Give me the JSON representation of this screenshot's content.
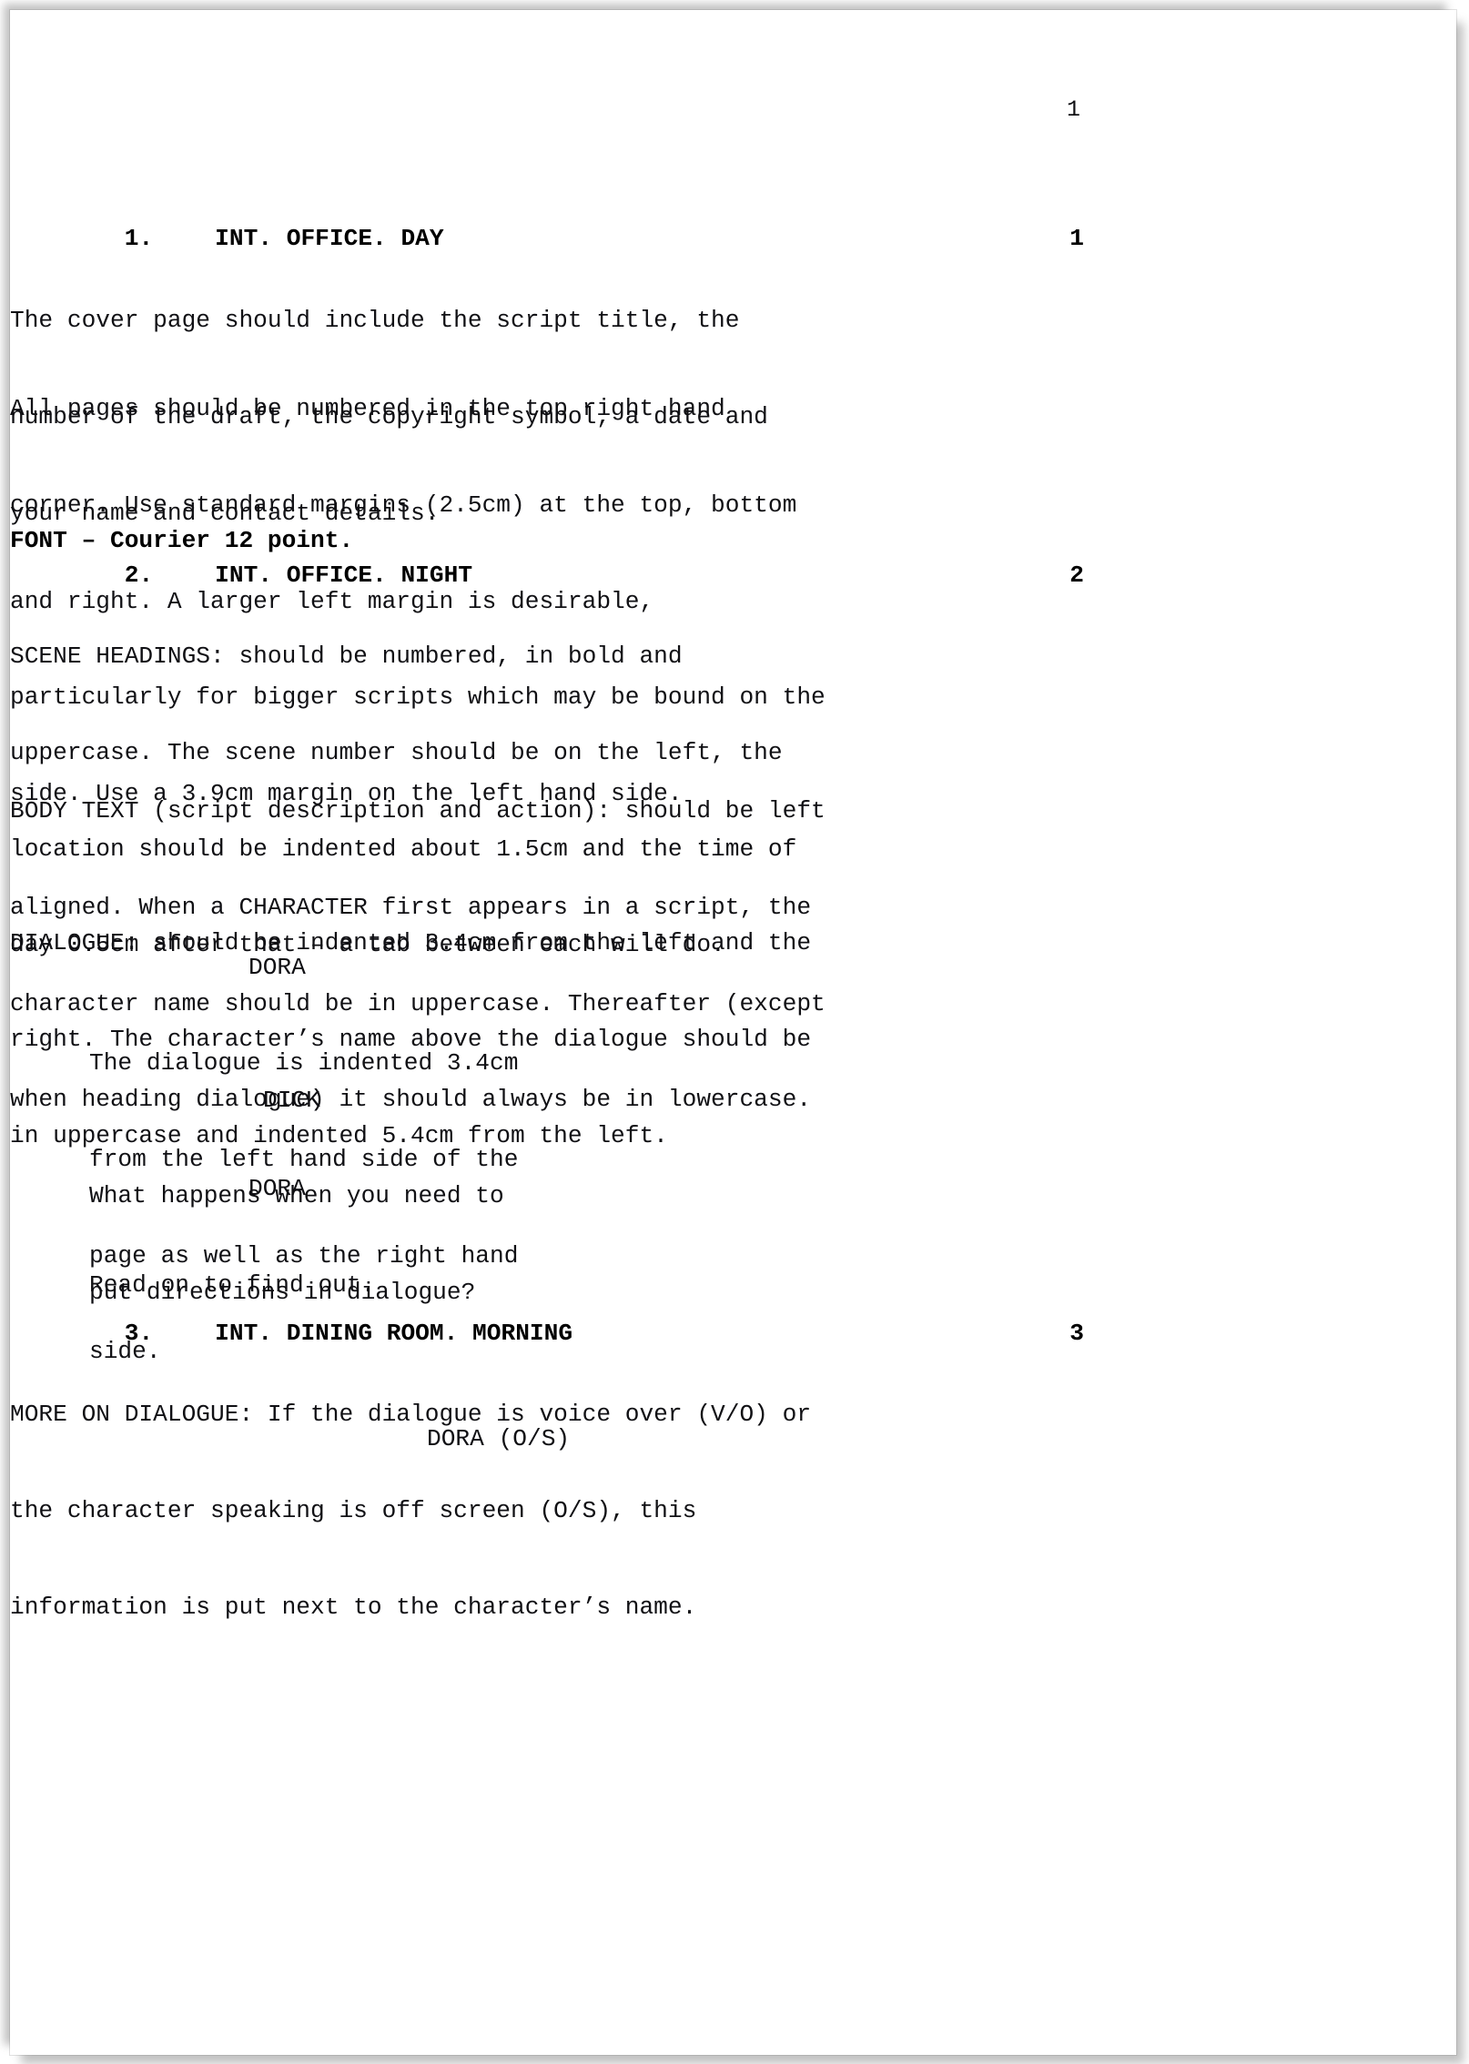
{
  "document": {
    "type": "screenplay-page",
    "page_number": "1",
    "font_note": "Courier 12 point",
    "text_color": "#101014",
    "page_background": "#ffffff"
  },
  "scenes": [
    {
      "number": "1.",
      "heading": "INT. OFFICE. DAY",
      "right_number": "1",
      "blocks": [
        {
          "kind": "action",
          "bold": false,
          "lines": [
            "The cover page should include the script title, the",
            "number of the draft, the copyright symbol, a date and",
            "your name and contact details."
          ]
        },
        {
          "kind": "action",
          "bold": false,
          "lines": [
            "All pages should be numbered in the top right hand",
            "corner. Use standard margins (2.5cm) at the top, bottom",
            "and right. A larger left margin is desirable,",
            "particularly for bigger scripts which may be bound on the",
            "side. Use a 3.9cm margin on the left hand side."
          ]
        },
        {
          "kind": "action",
          "bold": true,
          "lines": [
            "FONT – Courier 12 point."
          ]
        }
      ]
    },
    {
      "number": "2.",
      "heading": "INT. OFFICE. NIGHT",
      "right_number": "2",
      "blocks": [
        {
          "kind": "action",
          "bold": false,
          "lines": [
            "SCENE HEADINGS: should be numbered, in bold and",
            "uppercase. The scene number should be on the left, the",
            "location should be indented about 1.5cm and the time of",
            "day 0.5cm after that – a tab between each will do."
          ]
        },
        {
          "kind": "action",
          "bold": false,
          "lines": [
            "BODY TEXT (script description and action): should be left",
            "aligned. When a CHARACTER first appears in a script, the",
            "character name should be in uppercase. Thereafter (except",
            "when heading dialogue) it should always be in lowercase."
          ]
        },
        {
          "kind": "action",
          "bold": false,
          "lines": [
            "DIALOGUE: should be indented 3.4cm from the left and the",
            "right. The character’s name above the dialogue should be",
            "in uppercase and indented 5.4cm from the left."
          ]
        },
        {
          "kind": "dialogue",
          "character": "DORA",
          "lines": [
            "The dialogue is indented 3.4cm",
            "from the left hand side of the",
            "page as well as the right hand",
            "side."
          ]
        },
        {
          "kind": "dialogue",
          "character": "DICK",
          "lines": [
            "What happens when you need to",
            "put directions in dialogue?"
          ]
        },
        {
          "kind": "dialogue",
          "character": "DORA",
          "lines": [
            "Read on to find out."
          ]
        }
      ]
    },
    {
      "number": "3.",
      "heading": "INT. DINING ROOM. MORNING",
      "right_number": "3",
      "blocks": [
        {
          "kind": "action",
          "bold": false,
          "lines": [
            "MORE ON DIALOGUE: If the dialogue is voice over (V/O) or",
            "the character speaking is off screen (O/S), this",
            "information is put next to the character’s name."
          ]
        },
        {
          "kind": "dialogue",
          "character": "DORA (O/S)",
          "lines": []
        }
      ]
    }
  ],
  "lines": {
    "pagenum": "1",
    "s1_num": "1.",
    "s1_head": "INT. OFFICE. DAY",
    "s1_right": "1",
    "p1l1": "The cover page should include the script title, the",
    "p1l2": "number of the draft, the copyright symbol, a date and",
    "p1l3": "your name and contact details.",
    "p2l1": "All pages should be numbered in the top right hand",
    "p2l2": "corner. Use standard margins (2.5cm) at the top, bottom",
    "p2l3": "and right. A larger left margin is desirable,",
    "p2l4": "particularly for bigger scripts which may be bound on the",
    "p2l5": "side. Use a 3.9cm margin on the left hand side.",
    "p3l1": "FONT – Courier 12 point.",
    "s2_num": "2.",
    "s2_head": "INT. OFFICE. NIGHT",
    "s2_right": "2",
    "p4l1": "SCENE HEADINGS: should be numbered, in bold and",
    "p4l2": "uppercase. The scene number should be on the left, the",
    "p4l3": "location should be indented about 1.5cm and the time of",
    "p4l4": "day 0.5cm after that – a tab between each will do.",
    "p5l1": "BODY TEXT (script description and action): should be left",
    "p5l2": "aligned. When a CHARACTER first appears in a script, the",
    "p5l3": "character name should be in uppercase. Thereafter (except",
    "p5l4": "when heading dialogue) it should always be in lowercase.",
    "p6l1": "DIALOGUE: should be indented 3.4cm from the left and the",
    "p6l2": "right. The character’s name above the dialogue should be",
    "p6l3": "in uppercase and indented 5.4cm from the left.",
    "c1": "DORA",
    "d1l1": "The dialogue is indented 3.4cm",
    "d1l2": "from the left hand side of the",
    "d1l3": "page as well as the right hand",
    "d1l4": "side.",
    "c2": "DICK",
    "d2l1": "What happens when you need to",
    "d2l2": "put directions in dialogue?",
    "c3": "DORA",
    "d3l1": "Read on to find out.",
    "s3_num": "3.",
    "s3_head": "INT. DINING ROOM. MORNING",
    "s3_right": "3",
    "p7l1": "MORE ON DIALOGUE: If the dialogue is voice over (V/O) or",
    "p7l2": "the character speaking is off screen (O/S), this",
    "p7l3": "information is put next to the character’s name.",
    "c4": "DORA (O/S)"
  }
}
